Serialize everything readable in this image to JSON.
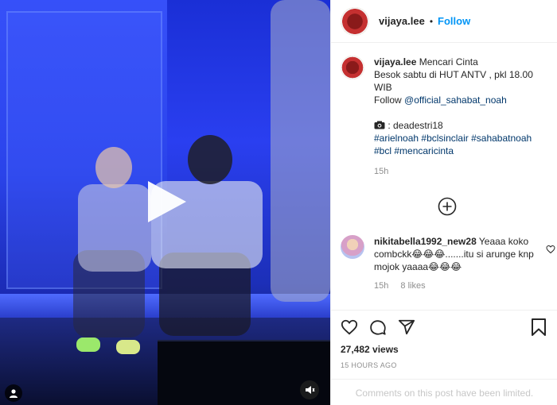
{
  "header": {
    "username": "vijaya.lee",
    "separator": "•",
    "follow_label": "Follow",
    "avatar_icon": "profile-avatar"
  },
  "caption": {
    "username": "vijaya.lee",
    "title": "Mencari Cinta",
    "line2": "Besok sabtu di HUT ANTV , pkl 18.00 WIB",
    "follow_prefix": "Follow",
    "follow_handle": "@official_sahabat_noah",
    "camera_icon": "camera-icon",
    "credit": ": deadestri18",
    "hashtags": [
      "#arielnoah",
      "#bclsinclair",
      "#sahabatnoah",
      "#bcl",
      "#mencaricinta"
    ],
    "time": "15h"
  },
  "load_more_icon": "plus-circle-icon",
  "comment": {
    "username": "nikitabella1992_new28",
    "text_start": "Yeaaa koko combckk",
    "emoji_1": "😂😂😂",
    "text_mid": ".......itu si arunge knp mojok yaaaa",
    "emoji_2": "😂😂😂",
    "time": "15h",
    "likes": "8 likes",
    "like_icon": "heart-outline-icon"
  },
  "actions": {
    "like_icon": "heart-icon",
    "comment_icon": "comment-icon",
    "share_icon": "paper-plane-icon",
    "save_icon": "bookmark-icon",
    "views": "27,482 views",
    "posted_ago": "15 HOURS AGO",
    "comments_limited": "Comments on this post have been limited."
  },
  "video": {
    "play_icon": "play-icon",
    "tagged_icon": "user-tag-icon",
    "sound_icon": "speaker-muted-icon",
    "background_color": "#2a3ff0"
  },
  "colors": {
    "accent": "#0095f6",
    "link": "#00376b",
    "muted": "#8e8e8e"
  }
}
